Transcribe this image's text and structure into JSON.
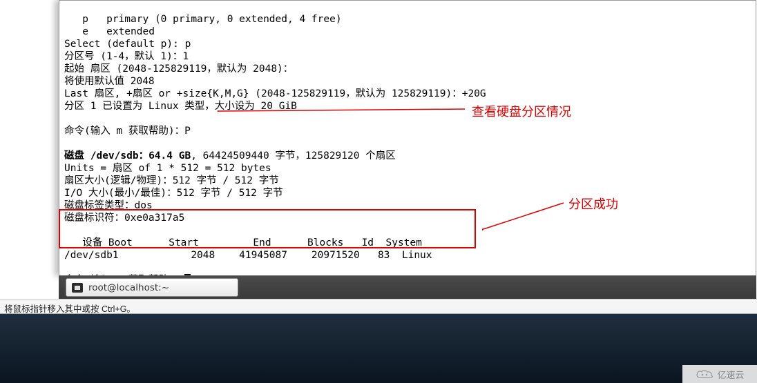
{
  "terminal": {
    "lines": {
      "l01": "   p   primary (0 primary, 0 extended, 4 free)",
      "l02": "   e   extended",
      "l03": "Select (default p): p",
      "l04": "分区号 (1-4，默认 1)：1",
      "l05": "起始 扇区 (2048-125829119，默认为 2048)：",
      "l06": "将使用默认值 2048",
      "l07": "Last 扇区, +扇区 or +size{K,M,G} (2048-125829119，默认为 125829119)：+20G",
      "l08": "分区 1 已设置为 Linux 类型，大小设为 20 GiB",
      "l09": "",
      "l10": "命令(输入 m 获取帮助)：P",
      "l11": "",
      "l12_a": "磁盘 /dev/sdb：64.4 GB",
      "l12_b": ", 64424509440 字节，125829120 个扇区",
      "l13": "Units = 扇区 of 1 * 512 = 512 bytes",
      "l14": "扇区大小(逻辑/物理)：512 字节 / 512 字节",
      "l15": "I/O 大小(最小/最佳)：512 字节 / 512 字节",
      "l16": "磁盘标签类型：dos",
      "l17": "磁盘标识符：0xe0a317a5",
      "l18": "",
      "l19": "   设备 Boot      Start         End      Blocks   Id  System",
      "l20": "/dev/sdb1            2048    41945087    20971520   83  Linux",
      "l21": "",
      "l22": "命令(输入 m 获取帮助)："
    }
  },
  "annotations": {
    "view_partition": "查看硬盘分区情况",
    "partition_success": "分区成功"
  },
  "taskbar": {
    "item_label": "root@localhost:~"
  },
  "status_bar": {
    "text": "将鼠标指针移入其中或按 Ctrl+G。"
  },
  "watermark": {
    "text": "亿速云"
  }
}
